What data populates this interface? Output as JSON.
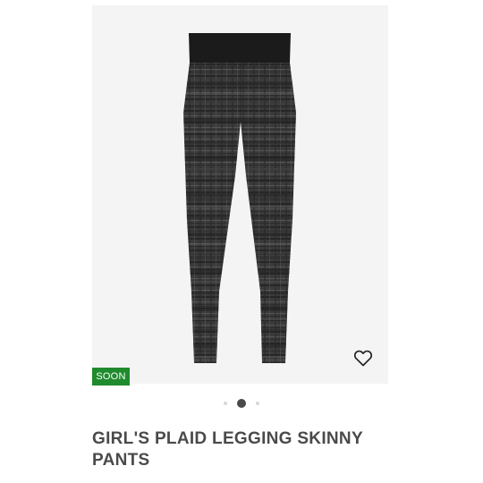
{
  "product": {
    "badge": "SOON",
    "title": "GIRL'S PLAID LEGGING SKINNY PANTS",
    "image_icon": "plaid-leggings-image",
    "wishlist_icon": "heart-outline-icon"
  },
  "carousel": {
    "total": 3,
    "active_index": 2
  },
  "colors": {
    "badge_bg": "#1f8a2e",
    "badge_text": "#ffffff",
    "title_text": "#4a4a4a",
    "image_bg": "#f4f4f4",
    "dot_active": "#4a4a4a",
    "dot_inactive": "#d8d8d8"
  }
}
